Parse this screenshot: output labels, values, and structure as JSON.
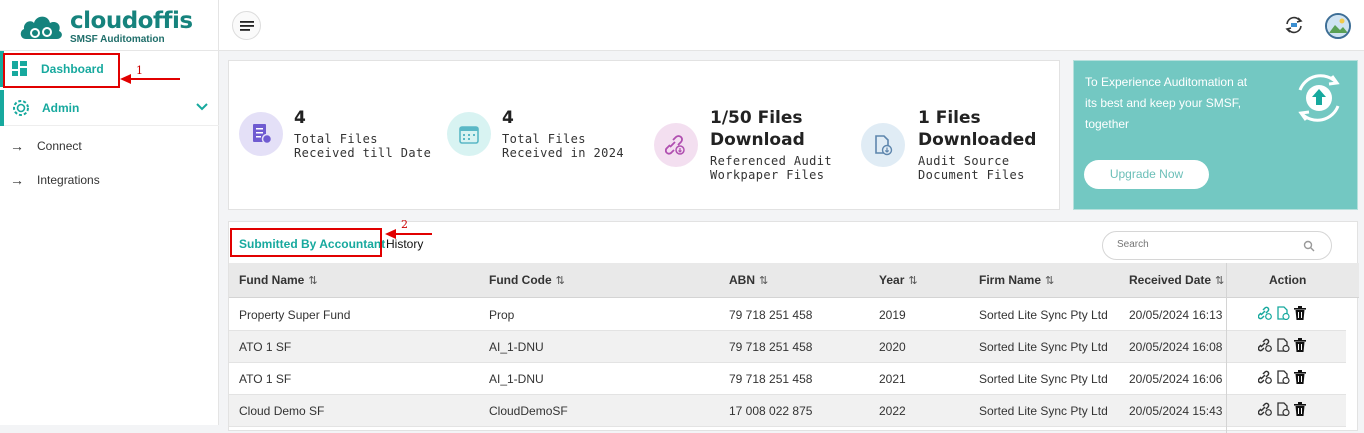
{
  "brand": {
    "name": "cloudoffis",
    "tagline": "SMSF Auditomation",
    "primary_color": "#17a99e"
  },
  "sidebar": {
    "items": [
      {
        "label": "Dashboard",
        "icon": "dashboard-grid-icon",
        "active": true
      },
      {
        "label": "Admin",
        "icon": "admin-gear-icon",
        "expanded": true
      },
      {
        "label": "Connect",
        "icon": "arrow-right-icon"
      },
      {
        "label": "Integrations",
        "icon": "arrow-right-icon"
      }
    ]
  },
  "topbar": {
    "menu_icon": "hamburger-menu-icon",
    "sync_icon": "sync-icon",
    "avatar_icon": "user-avatar-icon"
  },
  "stats": [
    {
      "number": "4",
      "desc": "Total Files Received till Date",
      "icon": "files-received-icon"
    },
    {
      "number": "4",
      "desc": "Total Files Received in 2024",
      "icon": "calendar-icon"
    },
    {
      "number": "1/50 Files Download",
      "desc": "Referenced Audit Workpaper Files",
      "icon": "link-download-icon"
    },
    {
      "number": "1 Files Downloaded",
      "desc": "Audit Source Document Files",
      "icon": "document-download-icon"
    }
  ],
  "promo": {
    "text": "To Experience Auditomation at its best and keep your SMSF, together",
    "button": "Upgrade Now",
    "icon": "upgrade-cycle-icon"
  },
  "table": {
    "tabs": [
      "Submitted By Accountant",
      "History"
    ],
    "search_placeholder": "Search",
    "columns": [
      "Fund Name",
      "Fund Code",
      "ABN",
      "Year",
      "Firm Name",
      "Received Date",
      "Action"
    ],
    "rows": [
      {
        "fund_name": "Property Super Fund",
        "fund_code": "Prop",
        "abn": "79 718 251 458",
        "year": "2019",
        "firm_name": "Sorted Lite Sync Pty Ltd",
        "received_date": "20/05/2024 16:13"
      },
      {
        "fund_name": "ATO 1 SF",
        "fund_code": "AI_1-DNU",
        "abn": "79 718 251 458",
        "year": "2020",
        "firm_name": "Sorted Lite Sync Pty Ltd",
        "received_date": "20/05/2024 16:08"
      },
      {
        "fund_name": "ATO 1 SF",
        "fund_code": "AI_1-DNU",
        "abn": "79 718 251 458",
        "year": "2021",
        "firm_name": "Sorted Lite Sync Pty Ltd",
        "received_date": "20/05/2024 16:06"
      },
      {
        "fund_name": "Cloud Demo SF",
        "fund_code": "CloudDemoSF",
        "abn": "17 008 022 875",
        "year": "2022",
        "firm_name": "Sorted Lite Sync Pty Ltd",
        "received_date": "20/05/2024 15:43"
      }
    ]
  },
  "annotations": {
    "marker1": "1",
    "marker2": "2",
    "color": "#e10000"
  }
}
